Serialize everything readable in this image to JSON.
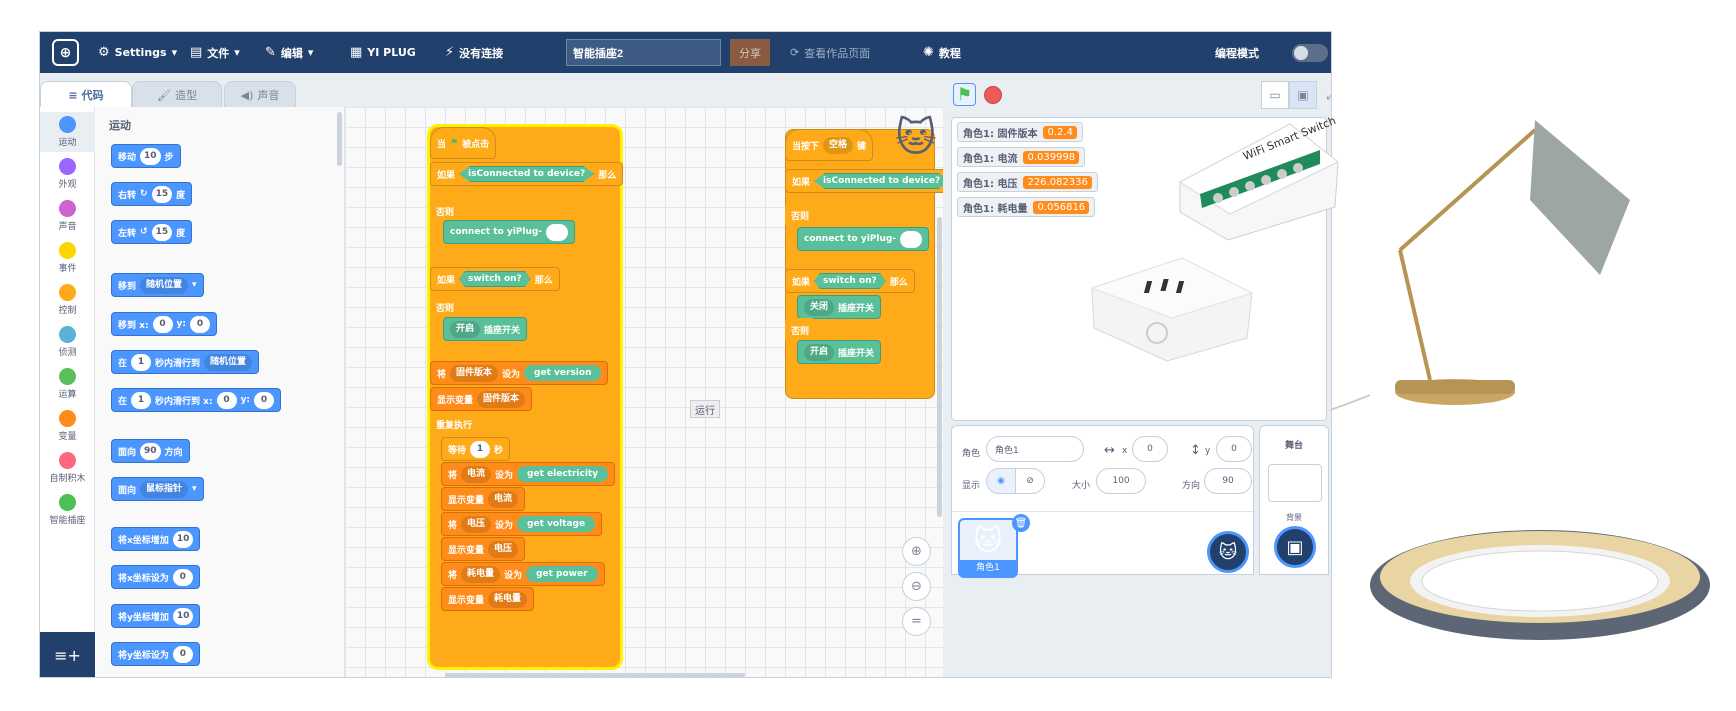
{
  "menubar": {
    "settings": "Settings",
    "file": "文件",
    "edit": "编辑",
    "plug": "YI PLUG",
    "connection": "没有连接",
    "project_title": "智能插座2",
    "share": "分享",
    "view_page": "查看作品页面",
    "tutorial": "教程",
    "mode": "编程模式"
  },
  "tabs": [
    "代码",
    "造型",
    "声音"
  ],
  "categories": [
    {
      "label": "运动",
      "color": "#4c97ff"
    },
    {
      "label": "外观",
      "color": "#9966ff"
    },
    {
      "label": "声音",
      "color": "#cf63cf"
    },
    {
      "label": "事件",
      "color": "#ffd500"
    },
    {
      "label": "控制",
      "color": "#ffab19"
    },
    {
      "label": "侦测",
      "color": "#5cb1d6"
    },
    {
      "label": "运算",
      "color": "#59c059"
    },
    {
      "label": "变量",
      "color": "#ff8c1a"
    },
    {
      "label": "自制积木",
      "color": "#ff6680"
    },
    {
      "label": "智能插座",
      "color": "#4cbf56"
    }
  ],
  "palette": {
    "heading": "运动",
    "move": "移动",
    "move_n": "10",
    "move_unit": "步",
    "turn_right": "右转",
    "turn_right_n": "15",
    "turn_deg": "度",
    "turn_left": "左转",
    "turn_left_n": "15",
    "goto": "移到",
    "goto_dd": "随机位置",
    "gotoxy": "移到 x:",
    "gotoxy_x": "0",
    "y_label": "y:",
    "gotoxy_y": "0",
    "glide_in": "在",
    "glide_secs": "1",
    "glide_to": "秒内滑行到",
    "glide_dd": "随机位置",
    "glide_to_xy": "秒内滑行到 x:",
    "glide_x": "0",
    "glide_y": "0",
    "point": "面向",
    "point_n": "90",
    "point_dir": "方向",
    "point_towards": "面向",
    "point_towards_dd": "鼠标指针",
    "change_x": "将x坐标增加",
    "change_x_n": "10",
    "set_x": "将x坐标设为",
    "set_x_n": "0",
    "change_y": "将y坐标增加",
    "change_y_n": "10",
    "set_y": "将y坐标设为",
    "set_y_n": "0"
  },
  "script1": {
    "hat": "当",
    "hat2": "被点击",
    "if": "如果",
    "then": "那么",
    "else": "否则",
    "is_connected": "isConnected to device?",
    "connect": "connect to yiPlug-",
    "switch_on": "switch on?",
    "open": "开启",
    "plug_switch": "插座开关",
    "set": "将",
    "fw_var": "固件版本",
    "set_to": "设为",
    "get_version": "get version",
    "show_var": "显示变量",
    "forever": "重复执行",
    "wait": "等待",
    "wait_n": "1",
    "sec": "秒",
    "current_var": "电流",
    "get_electricity": "get electricity",
    "voltage_var": "电压",
    "get_voltage": "get voltage",
    "power_var": "耗电量",
    "get_power": "get power"
  },
  "script2": {
    "hat": "当按下",
    "key": "空格",
    "key_suffix": "键",
    "if": "如果",
    "else": "否则",
    "then": "那么",
    "is_connected": "isConnected to device?",
    "connect": "connect to yiPlug-",
    "switch_on": "switch on?",
    "close": "关闭",
    "open": "开启",
    "plug_switch": "插座开关"
  },
  "tooltip": "运行",
  "monitors": [
    {
      "label": "角色1: 固件版本",
      "value": "0.2.4"
    },
    {
      "label": "角色1: 电流",
      "value": "0.039998"
    },
    {
      "label": "角色1: 电压",
      "value": "226.082336"
    },
    {
      "label": "角色1: 耗电量",
      "value": "0.056816"
    }
  ],
  "relay_label": "WiFi Smart Switch",
  "sprite_info": {
    "sprite_label": "角色",
    "sprite_name": "角色1",
    "x_label": "x",
    "x": "0",
    "y_label": "y",
    "y": "0",
    "show_label": "显示",
    "size_label": "大小",
    "size": "100",
    "dir_label": "方向",
    "dir": "90"
  },
  "sprite_thumb_name": "角色1",
  "stage_panel": {
    "title": "舞台",
    "backdrop": "背景"
  },
  "colors": {
    "menubar": "#21406b",
    "motion": "#4c97ff",
    "control": "#ffab19",
    "variable": "#ff8c1a",
    "extension": "#59c09a"
  }
}
